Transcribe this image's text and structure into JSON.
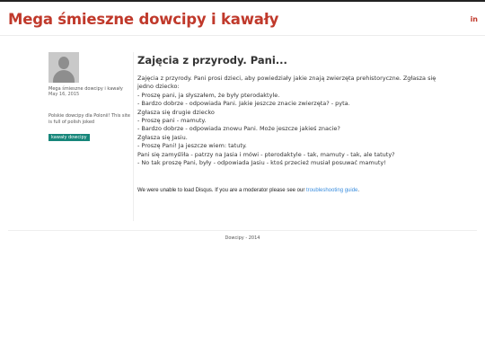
{
  "header": {
    "site_title": "Mega śmieszne dowcipy i kawały",
    "social_linkedin": "in"
  },
  "sidebar": {
    "author": "Mega śmieszne dowcipy i kawały",
    "date": "May 16, 2015",
    "description": "Polskie dowcipy dla Polonii! This site is full of polish joked",
    "tag": "kawały dowcipy"
  },
  "post": {
    "title": "Zajęcia z przyrody. Pani...",
    "lines": [
      "Zajęcia z przyrody. Pani prosi dzieci, aby powiedziały jakie znają zwierzęta prehistoryczne. Zgłasza się",
      "jedno dziecko:",
      "- Proszę pani, ja słyszałem, że były pterodaktyle.",
      "- Bardzo dobrze - odpowiada Pani. Jakie jeszcze znacie zwierzęta? - pyta.",
      "Zgłasza się drugie dziecko",
      "- Proszę pani - mamuty.",
      "- Bardzo dobrze - odpowiada znowu Pani. Może jeszcze jakieś znacie?",
      "Zgłasza się Jasiu.",
      "- Proszę Pani! Ja jeszcze wiem: tatuty.",
      "Pani się zamyśliła - patrzy na Jasia i mówi - pterodaktyle - tak, mamuty - tak, ale tatuty?",
      "- No tak proszę Pani, były - odpowiada Jasiu - ktoś przecież musiał posuwać mamuty!"
    ]
  },
  "disqus": {
    "message": "We were unable to load Disqus. If you are a moderator please see our ",
    "link_text": "troubleshooting guide",
    "suffix": "."
  },
  "footer": {
    "text": "Dowcipy - 2014"
  },
  "colors": {
    "brand": "#c0392b",
    "tag_bg": "#16867a",
    "link": "#3a8dde"
  }
}
